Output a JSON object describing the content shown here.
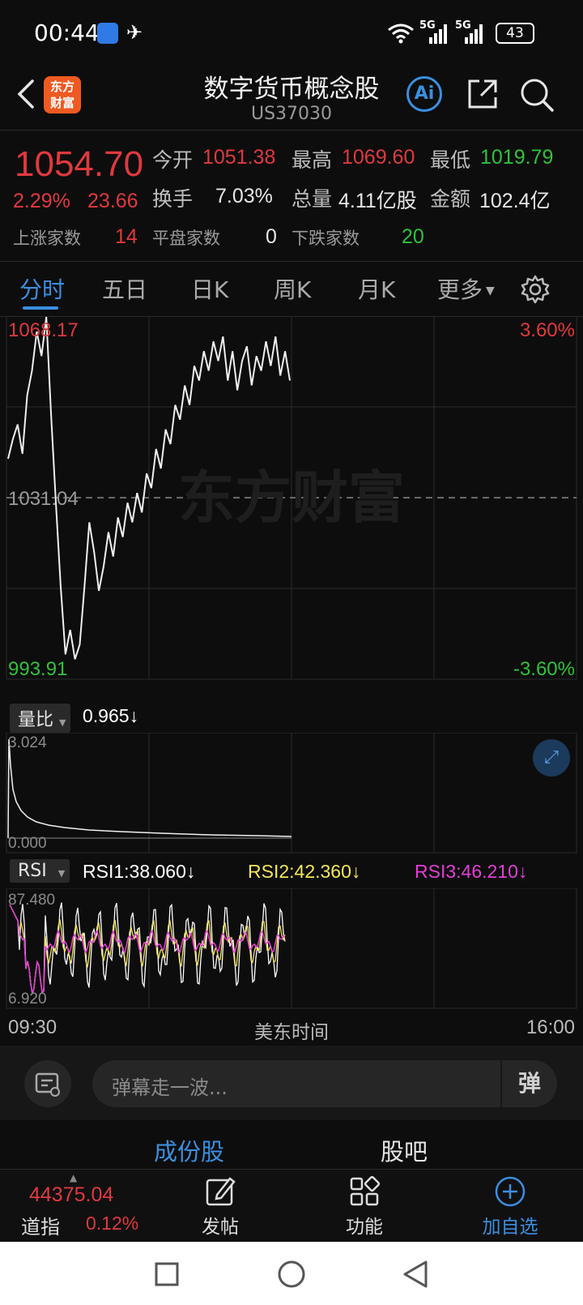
{
  "status_bar": {
    "time": "00:44",
    "network1": "5G",
    "network2": "5G",
    "battery": "43"
  },
  "header": {
    "title": "数字货币概念股",
    "code": "US37030",
    "logo_text_1": "东方",
    "logo_text_2": "财富",
    "ai_label": "Ai"
  },
  "quote": {
    "price": "1054.70",
    "change_pct": "2.29%",
    "change_abs": "23.66",
    "open_label": "今开",
    "open": "1051.38",
    "high_label": "最高",
    "high": "1069.60",
    "low_label": "最低",
    "low": "1019.79",
    "turnover_label": "换手",
    "turnover": "7.03%",
    "volume_label": "总量",
    "volume": "4.11亿股",
    "amount_label": "金额",
    "amount": "102.4亿",
    "up_label": "上涨家数",
    "up": "14",
    "flat_label": "平盘家数",
    "flat": "0",
    "down_label": "下跌家数",
    "down": "20"
  },
  "tabs": [
    "分时",
    "五日",
    "日K",
    "周K",
    "月K",
    "更多"
  ],
  "active_tab": "分时",
  "chart": {
    "watermark": "东方财富",
    "max_price": "1068.17",
    "mid_price": "1031.04",
    "min_price": "993.91",
    "max_pct": "3.60%",
    "min_pct": "-3.60%",
    "start_time": "09:30",
    "time_label": "美东时间",
    "end_time": "16:00"
  },
  "volume_ratio": {
    "selector": "量比",
    "value": "0.965",
    "arrow": "↓",
    "max": "3.024",
    "min": "0.000"
  },
  "rsi": {
    "selector": "RSI",
    "rsi1": "RSI1:38.060",
    "rsi2": "RSI2:42.360",
    "rsi3": "RSI3:46.210",
    "arrow": "↓",
    "max": "87.480",
    "min": "6.920",
    "colors": {
      "rsi1": "#ffffff",
      "rsi2": "#f5e65a",
      "rsi3": "#e23fd6"
    }
  },
  "comment": {
    "placeholder": "弹幕走一波...",
    "danmu_icon_text": "弹"
  },
  "sections": {
    "constituents": "成份股",
    "forum": "股吧"
  },
  "bottom_nav": {
    "index_value": "44375.04",
    "index_name": "道指",
    "index_change": "0.12%",
    "post": "发帖",
    "functions": "功能",
    "add_watch": "加自选"
  },
  "chart_data": {
    "type": "line",
    "title": "",
    "x_range": [
      "09:30",
      "16:00"
    ],
    "ylim": [
      993.91,
      1068.17
    ],
    "reference": 1031.04,
    "series": [
      {
        "values": [
          1039,
          1043,
          1046,
          1040,
          1052,
          1057,
          1065,
          1060,
          1068,
          1048,
          1030,
          1013,
          999,
          1004,
          998,
          1001,
          1013,
          1026,
          1020,
          1012,
          1017,
          1024,
          1019,
          1027,
          1023,
          1030,
          1026,
          1032,
          1028,
          1036,
          1033,
          1041,
          1037,
          1045,
          1042,
          1050,
          1047,
          1054,
          1050,
          1058,
          1055,
          1061,
          1057,
          1063,
          1059,
          1064,
          1055,
          1061,
          1053,
          1059,
          1062,
          1054,
          1060,
          1057,
          1063,
          1058,
          1064,
          1056,
          1061,
          1055
        ]
      }
    ]
  }
}
